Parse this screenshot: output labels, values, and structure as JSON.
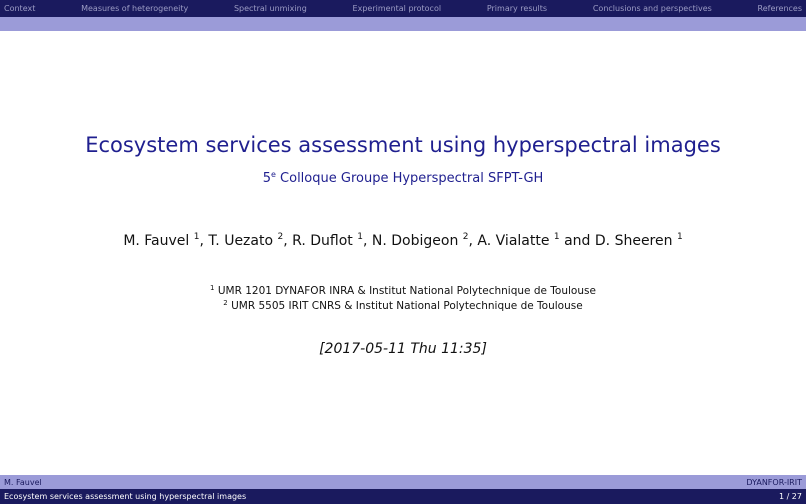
{
  "nav": {
    "items": [
      "Context",
      "Measures of heterogeneity",
      "Spectral unmixing",
      "Experimental protocol",
      "Primary results",
      "Conclusions and perspectives",
      "References"
    ]
  },
  "slide": {
    "title": "Ecosystem services assessment using hyperspectral images",
    "subtitle_prefix": "5",
    "subtitle_sup": "e",
    "subtitle_rest": " Colloque Groupe Hyperspectral SFPT-GH",
    "authors": [
      {
        "name": "M. Fauvel",
        "aff": "1"
      },
      {
        "name": "T. Uezato",
        "aff": "2"
      },
      {
        "name": "R. Duflot",
        "aff": "1"
      },
      {
        "name": "N. Dobigeon",
        "aff": "2"
      },
      {
        "name": "A. Vialatte",
        "aff": "1"
      },
      {
        "name": "D. Sheeren",
        "aff": "1"
      }
    ],
    "affiliations": [
      {
        "num": "1",
        "text": "UMR 1201 DYNAFOR INRA & Institut National Polytechnique de Toulouse"
      },
      {
        "num": "2",
        "text": "UMR 5505 IRIT CNRS & Institut National Polytechnique de Toulouse"
      }
    ],
    "date": "[2017-05-11 Thu 11:35]"
  },
  "footer": {
    "author": "M. Fauvel",
    "institute": "DYANFOR-IRIT",
    "short_title": "Ecosystem services assessment using hyperspectral images",
    "page": "1 / 27"
  }
}
